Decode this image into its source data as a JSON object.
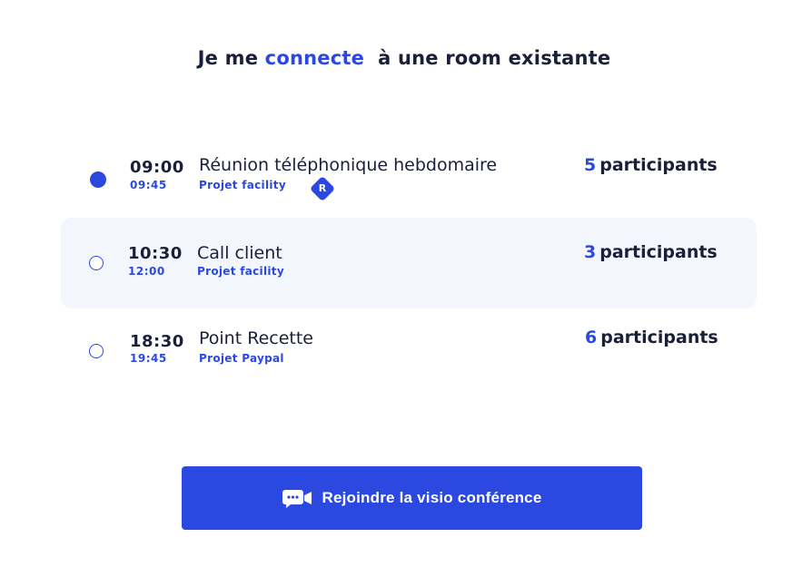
{
  "heading": {
    "part1": "Je me",
    "accent": "connecte",
    "part2": "à une room existante"
  },
  "rooms": [
    {
      "start": "09:00",
      "end": "09:45",
      "name": "Réunion téléphonique hebdomaire",
      "project": "Projet facility",
      "participants_count": "5",
      "participants_label": "participants",
      "avatar": "R",
      "selected": true,
      "highlighted": false
    },
    {
      "start": "10:30",
      "end": "12:00",
      "name": "Call client",
      "project": "Projet facility",
      "participants_count": "3",
      "participants_label": "participants",
      "selected": false,
      "highlighted": true
    },
    {
      "start": "18:30",
      "end": "19:45",
      "name": "Point Recette",
      "project": "Projet Paypal",
      "participants_count": "6",
      "participants_label": "participants",
      "selected": false,
      "highlighted": false
    }
  ],
  "join_button": {
    "label": "Rejoindre la visio conférence",
    "icon": "video-chat-icon"
  },
  "colors": {
    "accent": "#2b49e0",
    "text": "#1c1f3a",
    "highlight_bg": "#f3f6fc"
  }
}
